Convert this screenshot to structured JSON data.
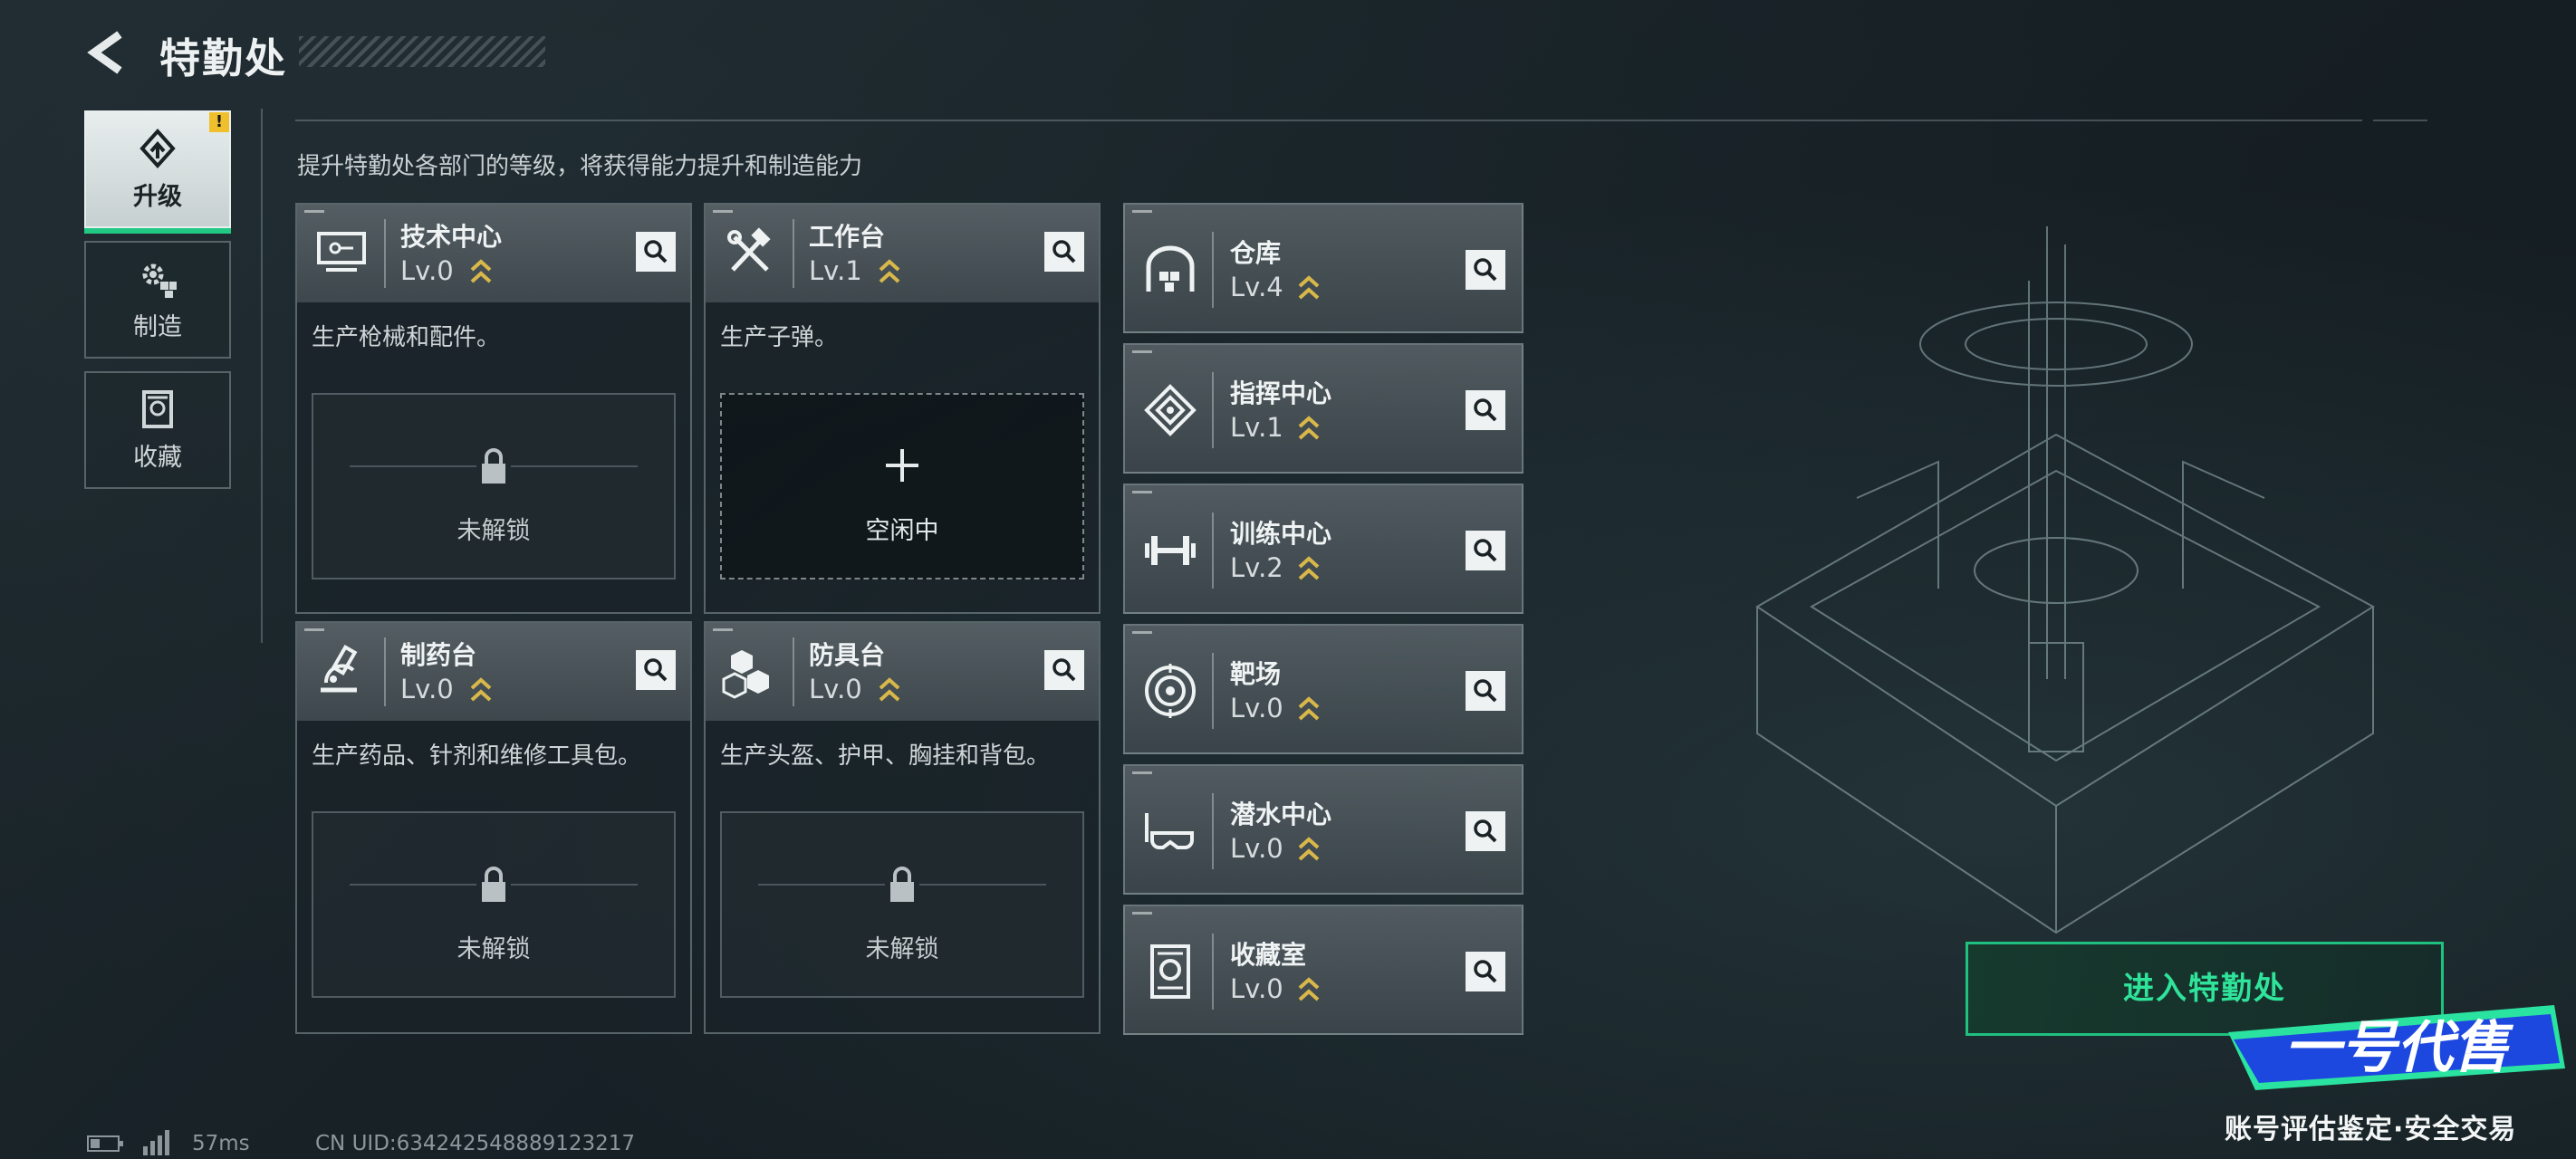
{
  "header": {
    "title": "特勤处"
  },
  "nav": [
    {
      "label": "升级",
      "active": true,
      "icon": "upgrade-icon",
      "warn": "!"
    },
    {
      "label": "制造",
      "active": false,
      "icon": "gear-cube-icon"
    },
    {
      "label": "收藏",
      "active": false,
      "icon": "collection-icon"
    }
  ],
  "subtitle": "提升特勤处各部门的等级，将获得能力提升和制造能力",
  "cards": [
    {
      "name": "技术中心",
      "level": "Lv.0",
      "desc": "生产枪械和配件。",
      "slot": "未解锁",
      "state": "locked",
      "icon": "computer-icon"
    },
    {
      "name": "工作台",
      "level": "Lv.1",
      "desc": "生产子弹。",
      "slot": "空闲中",
      "state": "idle",
      "icon": "tools-icon"
    },
    {
      "name": "制药台",
      "level": "Lv.0",
      "desc": "生产药品、针剂和维修工具包。",
      "slot": "未解锁",
      "state": "locked",
      "icon": "microscope-icon"
    },
    {
      "name": "防具台",
      "level": "Lv.0",
      "desc": "生产头盔、护甲、胸挂和背包。",
      "slot": "未解锁",
      "state": "locked",
      "icon": "armor-blocks-icon"
    }
  ],
  "rows": [
    {
      "name": "仓库",
      "level": "Lv.4",
      "icon": "warehouse-icon"
    },
    {
      "name": "指挥中心",
      "level": "Lv.1",
      "icon": "command-chip-icon"
    },
    {
      "name": "训练中心",
      "level": "Lv.2",
      "icon": "dumbbell-icon"
    },
    {
      "name": "靶场",
      "level": "Lv.0",
      "icon": "target-icon"
    },
    {
      "name": "潜水中心",
      "level": "Lv.0",
      "icon": "diving-mask-icon"
    },
    {
      "name": "收藏室",
      "level": "Lv.0",
      "icon": "collection-room-icon"
    }
  ],
  "enter_button": "进入特勤处",
  "footer": {
    "ping": "57ms",
    "uid": "CN UID:634242548889123217"
  },
  "watermark": {
    "brand": "一号代售",
    "sub": "账号评估鉴定·安全交易"
  },
  "colors": {
    "accent": "#22c985",
    "warn": "#f0c02c",
    "level_chevron": "#d9b84a"
  }
}
